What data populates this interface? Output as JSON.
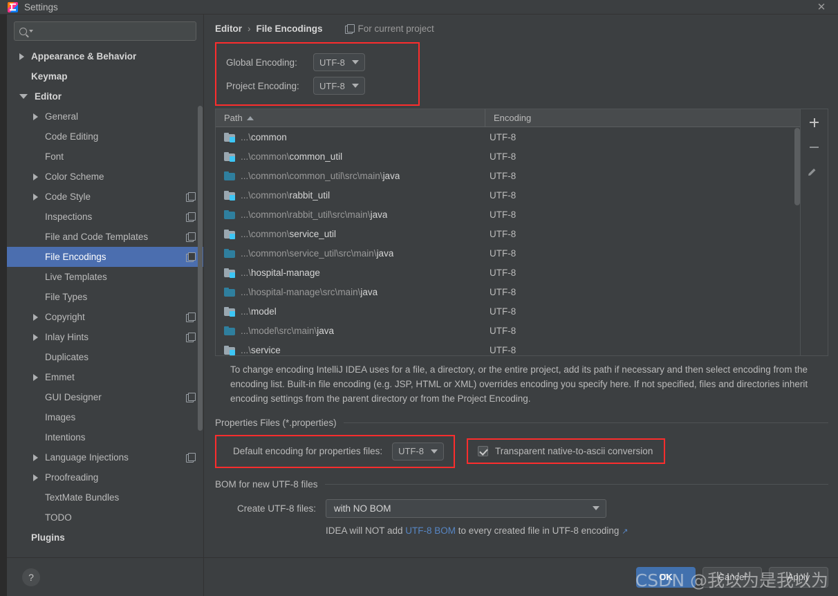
{
  "window": {
    "title": "Settings",
    "icon": "intellij-idea-icon",
    "close_label": "✕"
  },
  "search": {
    "value": "",
    "placeholder": ""
  },
  "sidebar": {
    "items": [
      {
        "label": "Appearance & Behavior",
        "arrow": "right",
        "indent": 0,
        "bold": true,
        "badge": false,
        "selected": false
      },
      {
        "label": "Keymap",
        "arrow": "none",
        "indent": 0,
        "bold": true,
        "badge": false,
        "selected": false
      },
      {
        "label": "Editor",
        "arrow": "down",
        "indent": 0,
        "bold": true,
        "badge": false,
        "selected": false
      },
      {
        "label": "General",
        "arrow": "right",
        "indent": 1,
        "bold": false,
        "badge": false,
        "selected": false
      },
      {
        "label": "Code Editing",
        "arrow": "none",
        "indent": 1,
        "bold": false,
        "badge": false,
        "selected": false
      },
      {
        "label": "Font",
        "arrow": "none",
        "indent": 1,
        "bold": false,
        "badge": false,
        "selected": false
      },
      {
        "label": "Color Scheme",
        "arrow": "right",
        "indent": 1,
        "bold": false,
        "badge": false,
        "selected": false
      },
      {
        "label": "Code Style",
        "arrow": "right",
        "indent": 1,
        "bold": false,
        "badge": true,
        "selected": false
      },
      {
        "label": "Inspections",
        "arrow": "none",
        "indent": 1,
        "bold": false,
        "badge": true,
        "selected": false
      },
      {
        "label": "File and Code Templates",
        "arrow": "none",
        "indent": 1,
        "bold": false,
        "badge": true,
        "selected": false
      },
      {
        "label": "File Encodings",
        "arrow": "none",
        "indent": 1,
        "bold": false,
        "badge": true,
        "selected": true
      },
      {
        "label": "Live Templates",
        "arrow": "none",
        "indent": 1,
        "bold": false,
        "badge": false,
        "selected": false
      },
      {
        "label": "File Types",
        "arrow": "none",
        "indent": 1,
        "bold": false,
        "badge": false,
        "selected": false
      },
      {
        "label": "Copyright",
        "arrow": "right",
        "indent": 1,
        "bold": false,
        "badge": true,
        "selected": false
      },
      {
        "label": "Inlay Hints",
        "arrow": "right",
        "indent": 1,
        "bold": false,
        "badge": true,
        "selected": false
      },
      {
        "label": "Duplicates",
        "arrow": "none",
        "indent": 1,
        "bold": false,
        "badge": false,
        "selected": false
      },
      {
        "label": "Emmet",
        "arrow": "right",
        "indent": 1,
        "bold": false,
        "badge": false,
        "selected": false
      },
      {
        "label": "GUI Designer",
        "arrow": "none",
        "indent": 1,
        "bold": false,
        "badge": true,
        "selected": false
      },
      {
        "label": "Images",
        "arrow": "none",
        "indent": 1,
        "bold": false,
        "badge": false,
        "selected": false
      },
      {
        "label": "Intentions",
        "arrow": "none",
        "indent": 1,
        "bold": false,
        "badge": false,
        "selected": false
      },
      {
        "label": "Language Injections",
        "arrow": "right",
        "indent": 1,
        "bold": false,
        "badge": true,
        "selected": false
      },
      {
        "label": "Proofreading",
        "arrow": "right",
        "indent": 1,
        "bold": false,
        "badge": false,
        "selected": false
      },
      {
        "label": "TextMate Bundles",
        "arrow": "none",
        "indent": 1,
        "bold": false,
        "badge": false,
        "selected": false
      },
      {
        "label": "TODO",
        "arrow": "none",
        "indent": 1,
        "bold": false,
        "badge": false,
        "selected": false
      },
      {
        "label": "Plugins",
        "arrow": "none",
        "indent": 0,
        "bold": true,
        "badge": false,
        "selected": false
      }
    ],
    "help_label": "?"
  },
  "header": {
    "breadcrumb_parent": "Editor",
    "breadcrumb_sep": "›",
    "breadcrumb_current": "File Encodings",
    "scope_note": "For current project"
  },
  "encoding": {
    "global_label": "Global Encoding:",
    "global_value": "UTF-8",
    "project_label": "Project Encoding:",
    "project_value": "UTF-8"
  },
  "table": {
    "columns": [
      "Path",
      "Encoding"
    ],
    "sort_column": "Path",
    "sort_direction": "ascending",
    "rows": [
      {
        "icon": "module-folder-icon",
        "dim": "...\\",
        "lit": "common",
        "encoding": "UTF-8"
      },
      {
        "icon": "module-folder-icon",
        "dim": "...\\common\\",
        "lit": "common_util",
        "encoding": "UTF-8"
      },
      {
        "icon": "source-folder-icon",
        "dim": "...\\common\\common_util\\src\\main\\",
        "lit": "java",
        "encoding": "UTF-8"
      },
      {
        "icon": "module-folder-icon",
        "dim": "...\\common\\",
        "lit": "rabbit_util",
        "encoding": "UTF-8"
      },
      {
        "icon": "source-folder-icon",
        "dim": "...\\common\\rabbit_util\\src\\main\\",
        "lit": "java",
        "encoding": "UTF-8"
      },
      {
        "icon": "module-folder-icon",
        "dim": "...\\common\\",
        "lit": "service_util",
        "encoding": "UTF-8"
      },
      {
        "icon": "source-folder-icon",
        "dim": "...\\common\\service_util\\src\\main\\",
        "lit": "java",
        "encoding": "UTF-8"
      },
      {
        "icon": "module-folder-icon",
        "dim": "...\\",
        "lit": "hospital-manage",
        "encoding": "UTF-8"
      },
      {
        "icon": "source-folder-icon",
        "dim": "...\\hospital-manage\\src\\main\\",
        "lit": "java",
        "encoding": "UTF-8"
      },
      {
        "icon": "module-folder-icon",
        "dim": "...\\",
        "lit": "model",
        "encoding": "UTF-8"
      },
      {
        "icon": "source-folder-icon",
        "dim": "...\\model\\src\\main\\",
        "lit": "java",
        "encoding": "UTF-8"
      },
      {
        "icon": "module-folder-icon",
        "dim": "...\\",
        "lit": "service",
        "encoding": "UTF-8"
      }
    ],
    "toolbar": {
      "add": "add-row-button",
      "remove": "remove-row-button",
      "edit": "edit-row-button"
    }
  },
  "description": "To change encoding IntelliJ IDEA uses for a file, a directory, or the entire project, add its path if necessary and then select encoding from the encoding list. Built-in file encoding (e.g. JSP, HTML or XML) overrides encoding you specify here. If not specified, files and directories inherit encoding settings from the parent directory or from the Project Encoding.",
  "properties_section": {
    "title": "Properties Files (*.properties)",
    "default_encoding_label": "Default encoding for properties files:",
    "default_encoding_value": "UTF-8",
    "transparent_label": "Transparent native-to-ascii conversion",
    "transparent_checked": true
  },
  "bom_section": {
    "title": "BOM for new UTF-8 files",
    "create_label": "Create UTF-8 files:",
    "create_value": "with NO BOM",
    "note_prefix": "IDEA will NOT add ",
    "note_link": "UTF-8 BOM",
    "note_suffix": " to every created file in UTF-8 encoding",
    "note_arrow": "↗"
  },
  "footer": {
    "ok": "OK",
    "cancel": "Cancel",
    "apply": "Apply",
    "watermark": "CSDN @我以为是我以为"
  },
  "colors": {
    "highlight_red": "#fd2d2d",
    "selection_blue": "#4b6eaf",
    "primary_button": "#4271ae",
    "link_blue": "#5786c4",
    "panel_bg": "#3c3f41"
  }
}
